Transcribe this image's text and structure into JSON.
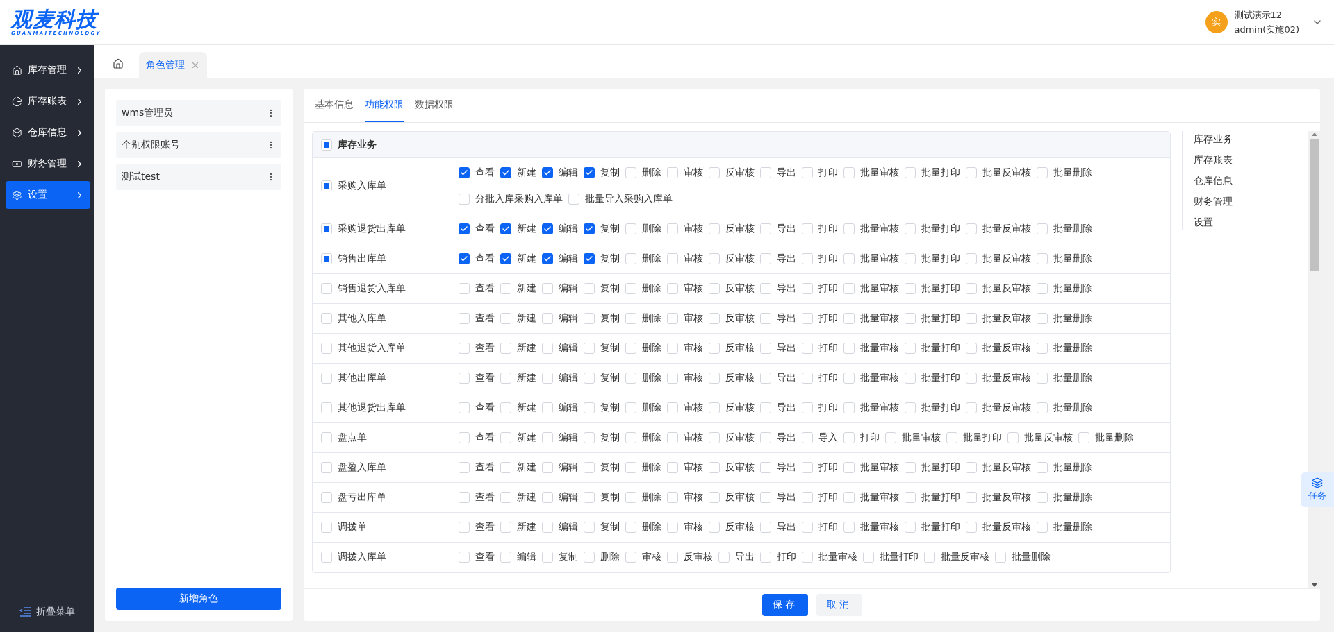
{
  "logo": {
    "name": "观麦科技",
    "subtitle": "GUANMAITECHNOLOGY"
  },
  "user": {
    "avatar": "实",
    "name": "测试演示12",
    "account": "admin(实施02)"
  },
  "sidebar": {
    "items": [
      {
        "label": "库存管理",
        "selected": false
      },
      {
        "label": "库存账表",
        "selected": false
      },
      {
        "label": "仓库信息",
        "selected": false
      },
      {
        "label": "财务管理",
        "selected": false
      },
      {
        "label": "设置",
        "selected": true
      }
    ],
    "collapse": "折叠菜单"
  },
  "page_tabs": [
    {
      "label": "角色管理",
      "selected": true
    }
  ],
  "roles": {
    "items": [
      {
        "name": "wms管理员"
      },
      {
        "name": "个别权限账号"
      },
      {
        "name": "测试test"
      }
    ],
    "add_button": "新增角色"
  },
  "detail_tabs": [
    {
      "label": "基本信息",
      "selected": false
    },
    {
      "label": "功能权限",
      "selected": true
    },
    {
      "label": "数据权限",
      "selected": false
    }
  ],
  "section": {
    "label": "库存业务",
    "indeterminate": true
  },
  "rows": [
    {
      "name": "采购入库单",
      "indeterminate": true,
      "perms": [
        {
          "label": "查看",
          "checked": true
        },
        {
          "label": "新建",
          "checked": true
        },
        {
          "label": "编辑",
          "checked": true
        },
        {
          "label": "复制",
          "checked": true
        },
        {
          "label": "删除",
          "checked": false
        },
        {
          "label": "审核",
          "checked": false
        },
        {
          "label": "反审核",
          "checked": false
        },
        {
          "label": "导出",
          "checked": false
        },
        {
          "label": "打印",
          "checked": false
        },
        {
          "label": "批量审核",
          "checked": false
        },
        {
          "label": "批量打印",
          "checked": false
        },
        {
          "label": "批量反审核",
          "checked": false
        },
        {
          "label": "批量删除",
          "checked": false
        },
        {
          "label": "分批入库采购入库单",
          "checked": false
        },
        {
          "label": "批量导入采购入库单",
          "checked": false
        }
      ]
    },
    {
      "name": "采购退货出库单",
      "indeterminate": true,
      "perms": [
        {
          "label": "查看",
          "checked": true
        },
        {
          "label": "新建",
          "checked": true
        },
        {
          "label": "编辑",
          "checked": true
        },
        {
          "label": "复制",
          "checked": true
        },
        {
          "label": "删除",
          "checked": false
        },
        {
          "label": "审核",
          "checked": false
        },
        {
          "label": "反审核",
          "checked": false
        },
        {
          "label": "导出",
          "checked": false
        },
        {
          "label": "打印",
          "checked": false
        },
        {
          "label": "批量审核",
          "checked": false
        },
        {
          "label": "批量打印",
          "checked": false
        },
        {
          "label": "批量反审核",
          "checked": false
        },
        {
          "label": "批量删除",
          "checked": false
        }
      ]
    },
    {
      "name": "销售出库单",
      "indeterminate": true,
      "perms": [
        {
          "label": "查看",
          "checked": true
        },
        {
          "label": "新建",
          "checked": true
        },
        {
          "label": "编辑",
          "checked": true
        },
        {
          "label": "复制",
          "checked": true
        },
        {
          "label": "删除",
          "checked": false
        },
        {
          "label": "审核",
          "checked": false
        },
        {
          "label": "反审核",
          "checked": false
        },
        {
          "label": "导出",
          "checked": false
        },
        {
          "label": "打印",
          "checked": false
        },
        {
          "label": "批量审核",
          "checked": false
        },
        {
          "label": "批量打印",
          "checked": false
        },
        {
          "label": "批量反审核",
          "checked": false
        },
        {
          "label": "批量删除",
          "checked": false
        }
      ]
    },
    {
      "name": "销售退货入库单",
      "indeterminate": false,
      "perms": [
        {
          "label": "查看",
          "checked": false
        },
        {
          "label": "新建",
          "checked": false
        },
        {
          "label": "编辑",
          "checked": false
        },
        {
          "label": "复制",
          "checked": false
        },
        {
          "label": "删除",
          "checked": false
        },
        {
          "label": "审核",
          "checked": false
        },
        {
          "label": "反审核",
          "checked": false
        },
        {
          "label": "导出",
          "checked": false
        },
        {
          "label": "打印",
          "checked": false
        },
        {
          "label": "批量审核",
          "checked": false
        },
        {
          "label": "批量打印",
          "checked": false
        },
        {
          "label": "批量反审核",
          "checked": false
        },
        {
          "label": "批量删除",
          "checked": false
        }
      ]
    },
    {
      "name": "其他入库单",
      "indeterminate": false,
      "perms": [
        {
          "label": "查看",
          "checked": false
        },
        {
          "label": "新建",
          "checked": false
        },
        {
          "label": "编辑",
          "checked": false
        },
        {
          "label": "复制",
          "checked": false
        },
        {
          "label": "删除",
          "checked": false
        },
        {
          "label": "审核",
          "checked": false
        },
        {
          "label": "反审核",
          "checked": false
        },
        {
          "label": "导出",
          "checked": false
        },
        {
          "label": "打印",
          "checked": false
        },
        {
          "label": "批量审核",
          "checked": false
        },
        {
          "label": "批量打印",
          "checked": false
        },
        {
          "label": "批量反审核",
          "checked": false
        },
        {
          "label": "批量删除",
          "checked": false
        }
      ]
    },
    {
      "name": "其他退货入库单",
      "indeterminate": false,
      "perms": [
        {
          "label": "查看",
          "checked": false
        },
        {
          "label": "新建",
          "checked": false
        },
        {
          "label": "编辑",
          "checked": false
        },
        {
          "label": "复制",
          "checked": false
        },
        {
          "label": "删除",
          "checked": false
        },
        {
          "label": "审核",
          "checked": false
        },
        {
          "label": "反审核",
          "checked": false
        },
        {
          "label": "导出",
          "checked": false
        },
        {
          "label": "打印",
          "checked": false
        },
        {
          "label": "批量审核",
          "checked": false
        },
        {
          "label": "批量打印",
          "checked": false
        },
        {
          "label": "批量反审核",
          "checked": false
        },
        {
          "label": "批量删除",
          "checked": false
        }
      ]
    },
    {
      "name": "其他出库单",
      "indeterminate": false,
      "perms": [
        {
          "label": "查看",
          "checked": false
        },
        {
          "label": "新建",
          "checked": false
        },
        {
          "label": "编辑",
          "checked": false
        },
        {
          "label": "复制",
          "checked": false
        },
        {
          "label": "删除",
          "checked": false
        },
        {
          "label": "审核",
          "checked": false
        },
        {
          "label": "反审核",
          "checked": false
        },
        {
          "label": "导出",
          "checked": false
        },
        {
          "label": "打印",
          "checked": false
        },
        {
          "label": "批量审核",
          "checked": false
        },
        {
          "label": "批量打印",
          "checked": false
        },
        {
          "label": "批量反审核",
          "checked": false
        },
        {
          "label": "批量删除",
          "checked": false
        }
      ]
    },
    {
      "name": "其他退货出库单",
      "indeterminate": false,
      "perms": [
        {
          "label": "查看",
          "checked": false
        },
        {
          "label": "新建",
          "checked": false
        },
        {
          "label": "编辑",
          "checked": false
        },
        {
          "label": "复制",
          "checked": false
        },
        {
          "label": "删除",
          "checked": false
        },
        {
          "label": "审核",
          "checked": false
        },
        {
          "label": "反审核",
          "checked": false
        },
        {
          "label": "导出",
          "checked": false
        },
        {
          "label": "打印",
          "checked": false
        },
        {
          "label": "批量审核",
          "checked": false
        },
        {
          "label": "批量打印",
          "checked": false
        },
        {
          "label": "批量反审核",
          "checked": false
        },
        {
          "label": "批量删除",
          "checked": false
        }
      ]
    },
    {
      "name": "盘点单",
      "indeterminate": false,
      "perms": [
        {
          "label": "查看",
          "checked": false
        },
        {
          "label": "新建",
          "checked": false
        },
        {
          "label": "编辑",
          "checked": false
        },
        {
          "label": "复制",
          "checked": false
        },
        {
          "label": "删除",
          "checked": false
        },
        {
          "label": "审核",
          "checked": false
        },
        {
          "label": "反审核",
          "checked": false
        },
        {
          "label": "导出",
          "checked": false
        },
        {
          "label": "导入",
          "checked": false
        },
        {
          "label": "打印",
          "checked": false
        },
        {
          "label": "批量审核",
          "checked": false
        },
        {
          "label": "批量打印",
          "checked": false
        },
        {
          "label": "批量反审核",
          "checked": false
        },
        {
          "label": "批量删除",
          "checked": false
        }
      ]
    },
    {
      "name": "盘盈入库单",
      "indeterminate": false,
      "perms": [
        {
          "label": "查看",
          "checked": false
        },
        {
          "label": "新建",
          "checked": false
        },
        {
          "label": "编辑",
          "checked": false
        },
        {
          "label": "复制",
          "checked": false
        },
        {
          "label": "删除",
          "checked": false
        },
        {
          "label": "审核",
          "checked": false
        },
        {
          "label": "反审核",
          "checked": false
        },
        {
          "label": "导出",
          "checked": false
        },
        {
          "label": "打印",
          "checked": false
        },
        {
          "label": "批量审核",
          "checked": false
        },
        {
          "label": "批量打印",
          "checked": false
        },
        {
          "label": "批量反审核",
          "checked": false
        },
        {
          "label": "批量删除",
          "checked": false
        }
      ]
    },
    {
      "name": "盘亏出库单",
      "indeterminate": false,
      "perms": [
        {
          "label": "查看",
          "checked": false
        },
        {
          "label": "新建",
          "checked": false
        },
        {
          "label": "编辑",
          "checked": false
        },
        {
          "label": "复制",
          "checked": false
        },
        {
          "label": "删除",
          "checked": false
        },
        {
          "label": "审核",
          "checked": false
        },
        {
          "label": "反审核",
          "checked": false
        },
        {
          "label": "导出",
          "checked": false
        },
        {
          "label": "打印",
          "checked": false
        },
        {
          "label": "批量审核",
          "checked": false
        },
        {
          "label": "批量打印",
          "checked": false
        },
        {
          "label": "批量反审核",
          "checked": false
        },
        {
          "label": "批量删除",
          "checked": false
        }
      ]
    },
    {
      "name": "调拨单",
      "indeterminate": false,
      "perms": [
        {
          "label": "查看",
          "checked": false
        },
        {
          "label": "新建",
          "checked": false
        },
        {
          "label": "编辑",
          "checked": false
        },
        {
          "label": "复制",
          "checked": false
        },
        {
          "label": "删除",
          "checked": false
        },
        {
          "label": "审核",
          "checked": false
        },
        {
          "label": "反审核",
          "checked": false
        },
        {
          "label": "导出",
          "checked": false
        },
        {
          "label": "打印",
          "checked": false
        },
        {
          "label": "批量审核",
          "checked": false
        },
        {
          "label": "批量打印",
          "checked": false
        },
        {
          "label": "批量反审核",
          "checked": false
        },
        {
          "label": "批量删除",
          "checked": false
        }
      ]
    },
    {
      "name": "调拨入库单",
      "indeterminate": false,
      "perms": [
        {
          "label": "查看",
          "checked": false
        },
        {
          "label": "编辑",
          "checked": false
        },
        {
          "label": "复制",
          "checked": false
        },
        {
          "label": "删除",
          "checked": false
        },
        {
          "label": "审核",
          "checked": false
        },
        {
          "label": "反审核",
          "checked": false
        },
        {
          "label": "导出",
          "checked": false
        },
        {
          "label": "打印",
          "checked": false
        },
        {
          "label": "批量审核",
          "checked": false
        },
        {
          "label": "批量打印",
          "checked": false
        },
        {
          "label": "批量反审核",
          "checked": false
        },
        {
          "label": "批量删除",
          "checked": false
        }
      ]
    }
  ],
  "anchor_nav": [
    {
      "label": "库存业务"
    },
    {
      "label": "库存账表"
    },
    {
      "label": "仓库信息"
    },
    {
      "label": "财务管理"
    },
    {
      "label": "设置"
    }
  ],
  "footer_buttons": [
    {
      "label": "保存",
      "kind": "primary"
    },
    {
      "label": "取消",
      "kind": "secondary"
    }
  ],
  "float_button": {
    "label": "任务"
  }
}
